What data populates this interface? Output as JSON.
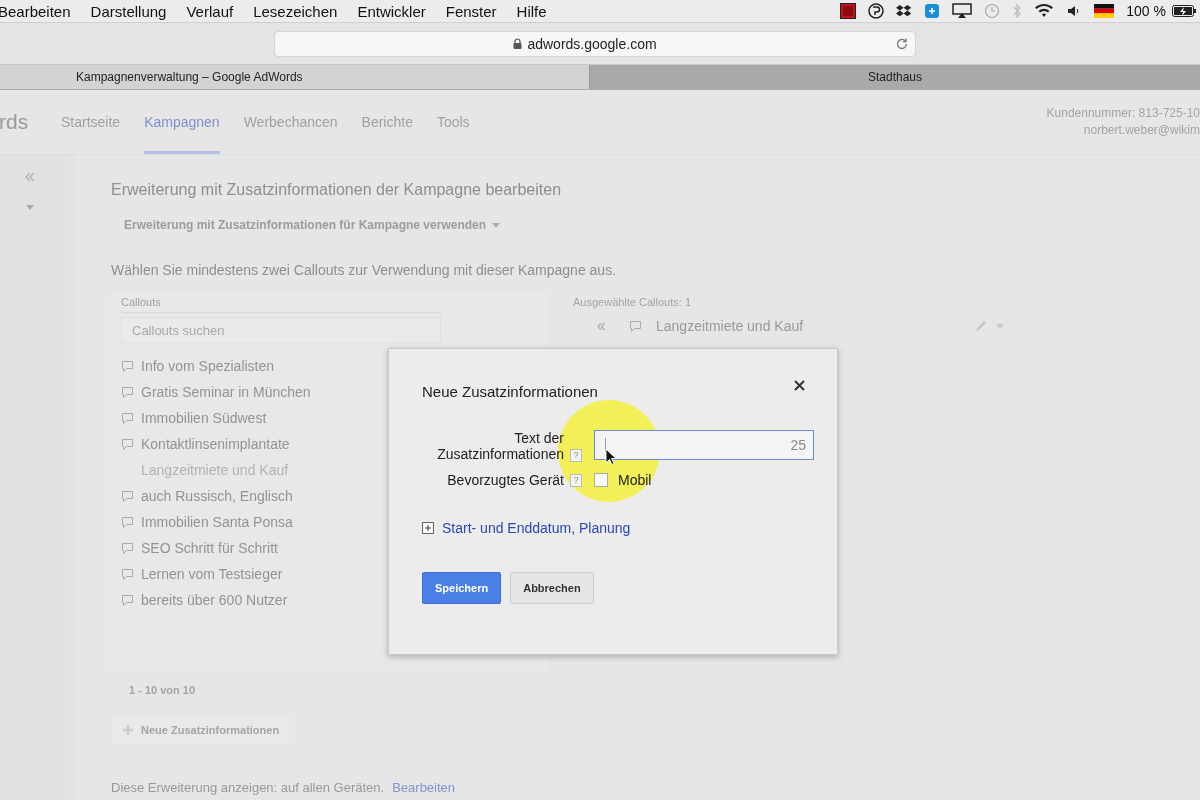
{
  "menubar": {
    "menus": [
      "Bearbeiten",
      "Darstellung",
      "Verlauf",
      "Lesezeichen",
      "Entwickler",
      "Fenster",
      "Hilfe"
    ],
    "battery_text": "100 %"
  },
  "browser": {
    "address": "adwords.google.com",
    "tabs": [
      {
        "label": "Kampagnenverwaltung – Google AdWords",
        "selected": true
      },
      {
        "label": "Stadthaus",
        "selected": false
      }
    ]
  },
  "page": {
    "logo": "rds",
    "nav": [
      {
        "label": "Startseite",
        "selected": false
      },
      {
        "label": "Kampagnen",
        "selected": true
      },
      {
        "label": "Werbechancen",
        "selected": false
      },
      {
        "label": "Berichte",
        "selected": false
      },
      {
        "label": "Tools",
        "selected": false
      }
    ],
    "account": [
      "Kundennummer: 813-725-10",
      "norbert.weber@wikim"
    ],
    "heading": "Erweiterung mit Zusatzinformationen der Kampagne bearbeiten",
    "usage_dropdown": "Erweiterung mit Zusatzinformationen für Kampagne verwenden",
    "instruction": "Wählen Sie mindestens zwei Callouts zur Verwendung mit dieser Kampagne aus.",
    "callouts": {
      "header": "Callouts",
      "search_placeholder": "Callouts suchen",
      "items": [
        {
          "text": "Info vom Spezialisten",
          "disabled": false
        },
        {
          "text": "Gratis Seminar in München",
          "disabled": false
        },
        {
          "text": "Immobilien Südwest",
          "disabled": false
        },
        {
          "text": "Kontaktlinsenimplantate",
          "disabled": false
        },
        {
          "text": "Langzeitmiete und Kauf",
          "disabled": true
        },
        {
          "text": "auch Russisch, Englisch",
          "disabled": false
        },
        {
          "text": "Immobilien Santa Ponsa",
          "disabled": false
        },
        {
          "text": "SEO Schritt für Schritt",
          "disabled": false
        },
        {
          "text": "Lernen vom Testsieger",
          "disabled": false
        },
        {
          "text": "bereits über 600 Nutzer",
          "disabled": false
        }
      ],
      "pagination": "1 - 10 von 10",
      "new_button": "Neue Zusatzinformationen"
    },
    "selected_callouts": {
      "header": "Ausgewählte Callouts: 1",
      "items": [
        "Langzeitmiete und Kauf"
      ]
    },
    "footer": {
      "text": "Diese Erweiterung anzeigen: auf allen Geräten.",
      "link": "Bearbeiten"
    }
  },
  "dialog": {
    "title": "Neue Zusatzinformationen",
    "text_label": "Text der Zusatzinformationen",
    "counter": "25",
    "help_marks": [
      "?",
      "?"
    ],
    "device_label": "Bevorzugtes Gerät",
    "mobile": {
      "label": "Mobil",
      "checked": false
    },
    "schedule_link": "Start- und Enddatum, Planung",
    "buttons": [
      {
        "label": "Speichern",
        "kind": "primary"
      },
      {
        "label": "Abbrechen",
        "kind": "secondary"
      }
    ]
  }
}
